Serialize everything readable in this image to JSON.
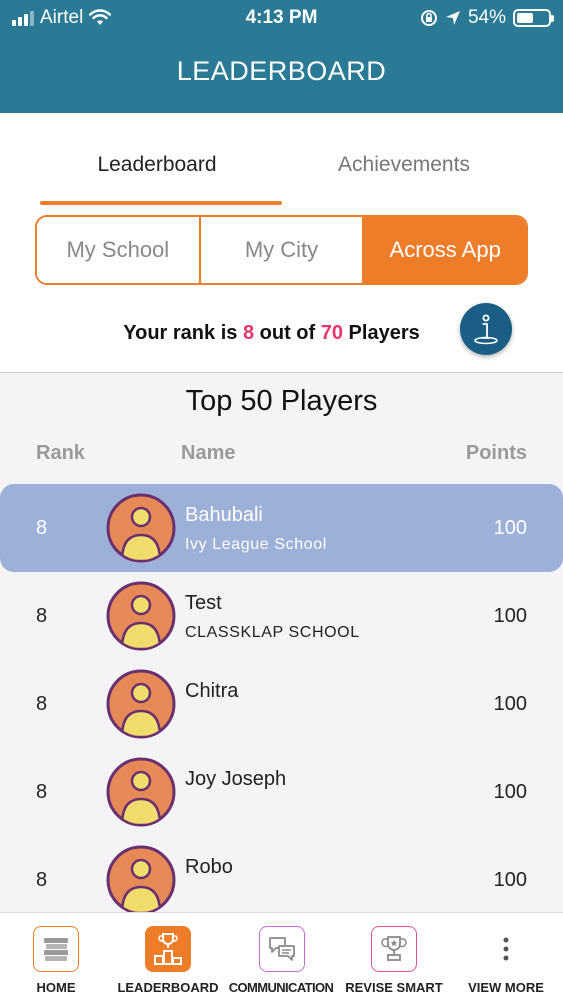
{
  "status": {
    "carrier": "Airtel",
    "time": "4:13 PM",
    "battery": "54%"
  },
  "header": {
    "title": "LEADERBOARD"
  },
  "tabs": [
    {
      "label": "Leaderboard",
      "active": true
    },
    {
      "label": "Achievements",
      "active": false
    }
  ],
  "scope": {
    "options": [
      "My School",
      "My City",
      "Across App"
    ],
    "selected": "Across App"
  },
  "rank": {
    "prefix": "Your rank is",
    "rank": "8",
    "middle": "out of",
    "total": "70",
    "suffix": "Players"
  },
  "list": {
    "title": "Top 50 Players",
    "columns": {
      "rank": "Rank",
      "name": "Name",
      "points": "Points"
    },
    "rows": [
      {
        "rank": "8",
        "name": "Bahubali",
        "school": "Ivy League School",
        "points": "100",
        "highlighted": true
      },
      {
        "rank": "8",
        "name": "Test",
        "school": "CLASSKLAP SCHOOL",
        "points": "100",
        "highlighted": false
      },
      {
        "rank": "8",
        "name": "Chitra",
        "school": "",
        "points": "100",
        "highlighted": false
      },
      {
        "rank": "8",
        "name": "Joy Joseph",
        "school": "",
        "points": "100",
        "highlighted": false
      },
      {
        "rank": "8",
        "name": "Robo",
        "school": "",
        "points": "100",
        "highlighted": false
      }
    ]
  },
  "nav": [
    {
      "label": "HOME",
      "icon": "books-icon"
    },
    {
      "label": "LEADERBOARD",
      "icon": "leaderboard-icon",
      "active": true
    },
    {
      "label": "COMMUNICATION",
      "icon": "chat-icon"
    },
    {
      "label": "REVISE SMART",
      "icon": "trophy-icon"
    },
    {
      "label": "VIEW MORE",
      "icon": "more-vertical-icon"
    }
  ],
  "colors": {
    "header": "#2a7a96",
    "accent": "#ee7d2a",
    "highlight_row": "#9db1d8",
    "rank_number": "#e8356a",
    "info_button": "#1b5e85"
  }
}
